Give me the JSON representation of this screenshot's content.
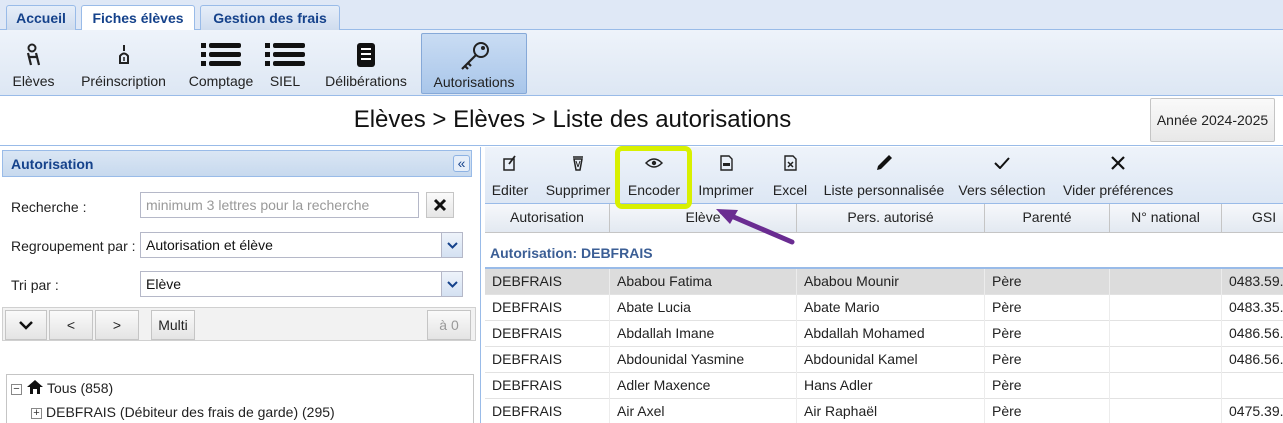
{
  "tabs": [
    {
      "label": "Accueil",
      "active": false
    },
    {
      "label": "Fiches élèves",
      "active": true
    },
    {
      "label": "Gestion des frais",
      "active": false
    }
  ],
  "ribbon": [
    {
      "label": "Elèves",
      "icon": "student-icon"
    },
    {
      "label": "Préinscription",
      "icon": "pen-icon"
    },
    {
      "label": "Comptage",
      "icon": "list-icon"
    },
    {
      "label": "SIEL",
      "icon": "list-icon"
    },
    {
      "label": "Délibérations",
      "icon": "document-icon"
    },
    {
      "label": "Autorisations",
      "icon": "key-icon",
      "active": true
    }
  ],
  "page": {
    "title": "Elèves > Elèves > Liste des autorisations",
    "year": "Année 2024-2025"
  },
  "left": {
    "header": "Autorisation",
    "search_label": "Recherche :",
    "search_placeholder": "minimum 3 lettres pour la recherche",
    "group_label": "Regroupement par :",
    "group_value": "Autorisation et élève",
    "sort_label": "Tri par :",
    "sort_value": "Elève",
    "nav": {
      "prev": "<",
      "next": ">",
      "multi": "Multi",
      "count": "à 0"
    },
    "tree": {
      "root": "Tous (858)",
      "child": "DEBFRAIS (Débiteur des frais de garde) (295)"
    }
  },
  "toolbar": [
    {
      "label": "Editer",
      "icon": "edit-icon"
    },
    {
      "label": "Supprimer",
      "icon": "trash-icon"
    },
    {
      "label": "Encoder",
      "icon": "eye-icon"
    },
    {
      "label": "Imprimer",
      "icon": "pdf-icon"
    },
    {
      "label": "Excel",
      "icon": "excel-icon"
    },
    {
      "label": "Liste personnalisée",
      "icon": "pencil-icon"
    },
    {
      "label": "Vers sélection",
      "icon": "check-icon"
    },
    {
      "label": "Vider préférences",
      "icon": "x-icon"
    }
  ],
  "grid": {
    "columns": [
      "Autorisation",
      "Elève",
      "Pers. autorisé",
      "Parenté",
      "N° national",
      "GSI"
    ],
    "group": "Autorisation: DEBFRAIS",
    "rows": [
      [
        "DEBFRAIS",
        "Ababou Fatima",
        "Ababou Mounir",
        "Père",
        "",
        "0483.59."
      ],
      [
        "DEBFRAIS",
        "Abate Lucia",
        "Abate Mario",
        "Père",
        "",
        "0483.35."
      ],
      [
        "DEBFRAIS",
        "Abdallah Imane",
        "Abdallah Mohamed",
        "Père",
        "",
        "0486.56."
      ],
      [
        "DEBFRAIS",
        "Abdounidal Yasmine",
        "Abdounidal Kamel",
        "Père",
        "",
        "0486.56."
      ],
      [
        "DEBFRAIS",
        "Adler Maxence",
        "Hans Adler",
        "Père",
        "",
        ""
      ],
      [
        "DEBFRAIS",
        "Air Axel",
        "Air Raphaël",
        "Père",
        "",
        "0475.39."
      ]
    ]
  },
  "colors": {
    "highlight": "#d8f000",
    "arrow": "#6a2c91",
    "accent": "#15428b"
  }
}
